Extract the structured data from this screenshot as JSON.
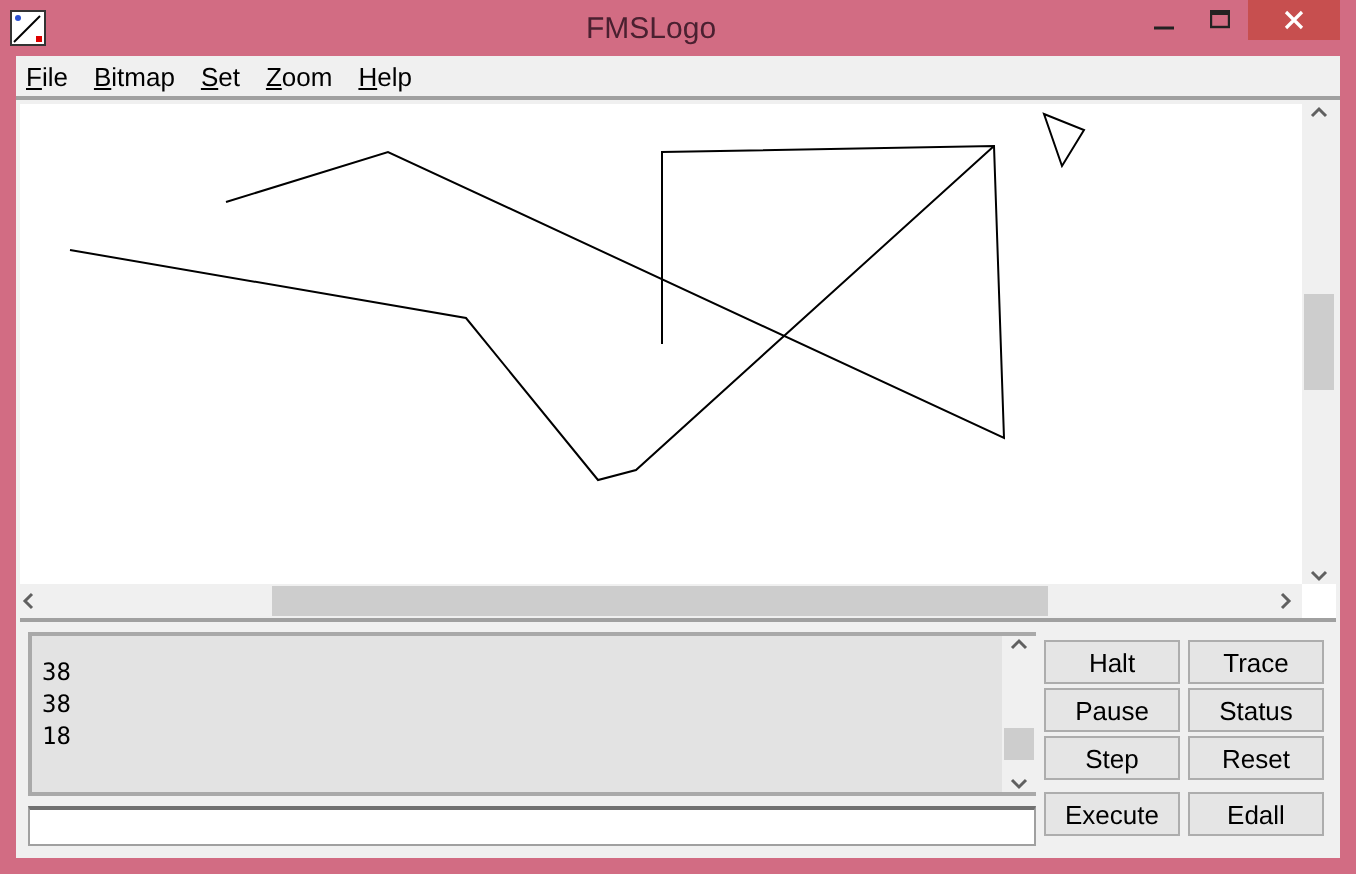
{
  "window": {
    "title": "FMSLogo"
  },
  "menu": [
    "File",
    "Bitmap",
    "Set",
    "Zoom",
    "Help"
  ],
  "output_lines": [
    "38",
    "38",
    "18"
  ],
  "buttons": [
    "Halt",
    "Trace",
    "Pause",
    "Status",
    "Step",
    "Reset"
  ],
  "bottom_buttons": [
    "Execute",
    "Edall"
  ]
}
